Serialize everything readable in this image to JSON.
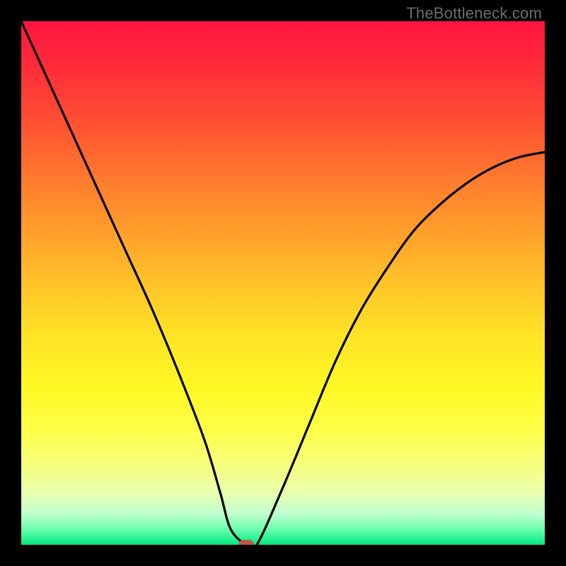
{
  "watermark": "TheBottleneck.com",
  "chart_data": {
    "type": "line",
    "title": "",
    "xlabel": "",
    "ylabel": "",
    "xlim": [
      0,
      100
    ],
    "ylim": [
      0,
      100
    ],
    "series": [
      {
        "name": "bottleneck-curve",
        "x": [
          0,
          5,
          10,
          15,
          20,
          25,
          30,
          35,
          38,
          40,
          43,
          45,
          50,
          55,
          60,
          65,
          70,
          75,
          80,
          85,
          90,
          95,
          100
        ],
        "values": [
          100,
          89,
          78,
          67,
          56,
          45,
          33,
          20,
          10,
          3,
          0,
          0,
          11,
          23,
          35,
          45,
          53,
          60,
          65,
          69,
          72,
          74,
          75
        ]
      }
    ],
    "marker": {
      "x": 43,
      "y": 0
    },
    "grid": false,
    "legend": false
  },
  "colors": {
    "curve": "#000000",
    "marker": "#c0574e",
    "frame": "#000000"
  }
}
